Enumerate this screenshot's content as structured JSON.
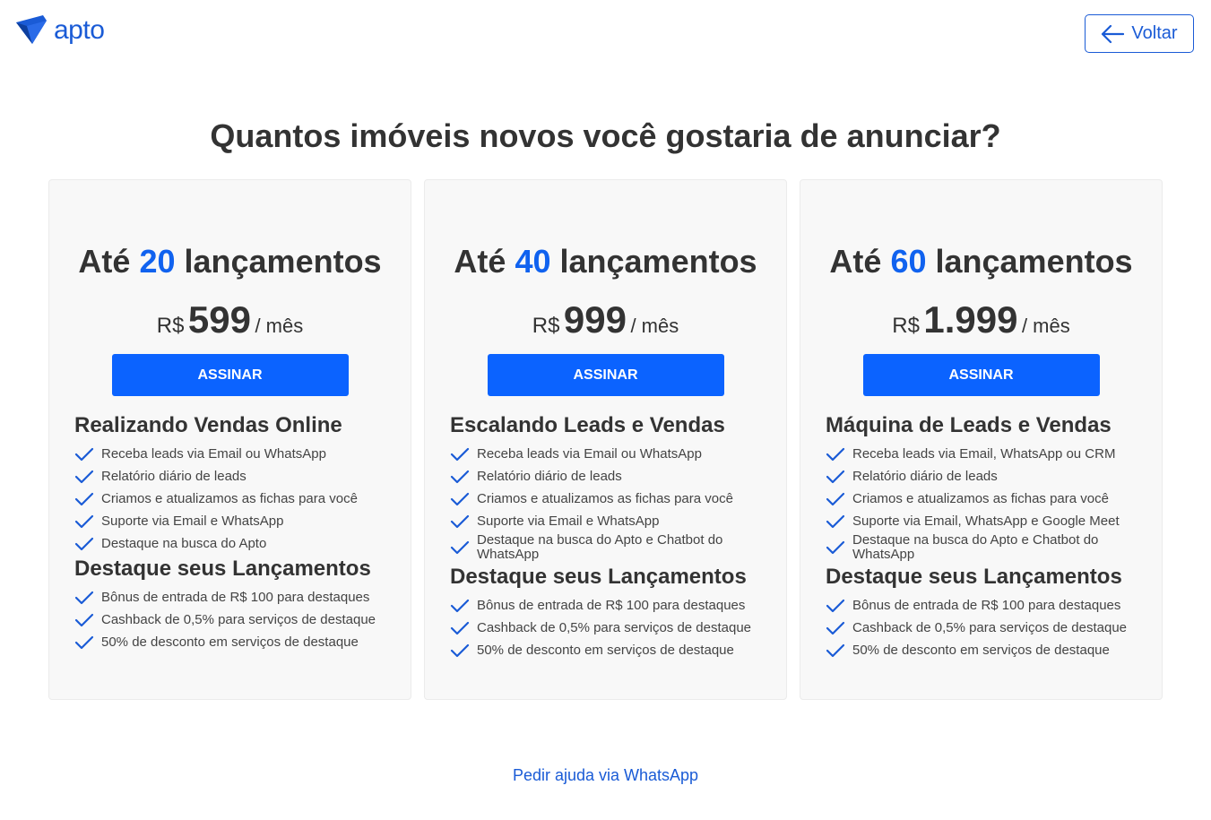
{
  "header": {
    "logo_text": "apto",
    "back_label": "Voltar"
  },
  "page": {
    "title": "Quantos imóveis novos você gostaria de anunciar?",
    "help_link": "Pedir ajuda via WhatsApp"
  },
  "colors": {
    "brand": "#1a5bd6",
    "accent_number": "#1062ef",
    "button": "#0b63ff",
    "card_background": "#f8f8f8"
  },
  "plans": [
    {
      "title_prefix": "Até",
      "title_number": "20",
      "title_suffix": "lançamentos",
      "currency": "R$",
      "price": "599",
      "period": "/ mês",
      "button_label": "ASSINAR",
      "section1_title": "Realizando Vendas Online",
      "section1_items": [
        "Receba leads via Email ou WhatsApp",
        "Relatório diário de leads",
        "Criamos e atualizamos as fichas para você",
        "Suporte via Email e WhatsApp",
        "Destaque na busca do Apto"
      ],
      "section2_title": "Destaque seus Lançamentos",
      "section2_items": [
        "Bônus de entrada de R$ 100 para destaques",
        "Cashback de 0,5% para serviços de destaque",
        "50% de desconto em serviços de destaque"
      ]
    },
    {
      "title_prefix": "Até",
      "title_number": "40",
      "title_suffix": "lançamentos",
      "currency": "R$",
      "price": "999",
      "period": "/ mês",
      "button_label": "ASSINAR",
      "section1_title": "Escalando Leads e Vendas",
      "section1_items": [
        "Receba leads via Email ou WhatsApp",
        "Relatório diário de leads",
        "Criamos e atualizamos as fichas para você",
        "Suporte via Email e WhatsApp",
        "Destaque na busca do Apto e Chatbot do WhatsApp"
      ],
      "section2_title": "Destaque seus Lançamentos",
      "section2_items": [
        "Bônus de entrada de R$ 100 para destaques",
        "Cashback de 0,5% para serviços de destaque",
        "50% de desconto em serviços de destaque"
      ]
    },
    {
      "title_prefix": "Até",
      "title_number": "60",
      "title_suffix": "lançamentos",
      "currency": "R$",
      "price": "1.999",
      "period": "/ mês",
      "button_label": "ASSINAR",
      "section1_title": "Máquina de Leads e Vendas",
      "section1_items": [
        "Receba leads via Email, WhatsApp ou CRM",
        "Relatório diário de leads",
        "Criamos e atualizamos as fichas para você",
        "Suporte via Email, WhatsApp e Google Meet",
        "Destaque na busca do Apto e Chatbot do WhatsApp"
      ],
      "section2_title": "Destaque seus Lançamentos",
      "section2_items": [
        "Bônus de entrada de R$ 100 para destaques",
        "Cashback de 0,5% para serviços de destaque",
        "50% de desconto em serviços de destaque"
      ]
    }
  ]
}
